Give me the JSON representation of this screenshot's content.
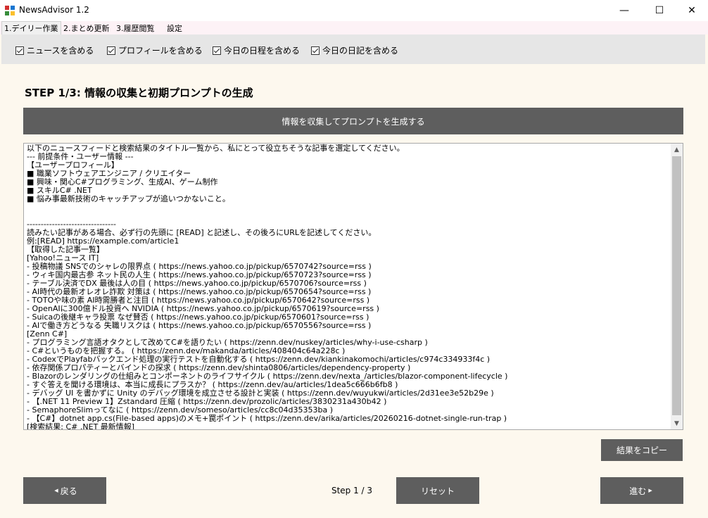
{
  "window": {
    "title": "NewsAdvisor 1.2",
    "minimize": "—",
    "maximize": "☐",
    "close": "✕"
  },
  "tabs": [
    {
      "label": "1.デイリー作業",
      "active": true
    },
    {
      "label": "2.まとめ更新",
      "active": false
    },
    {
      "label": "3.履歴閲覧",
      "active": false
    },
    {
      "label": "設定",
      "active": false
    }
  ],
  "options": [
    {
      "label": "ニュースを含める",
      "checked": true
    },
    {
      "label": "プロフィールを含める",
      "checked": true
    },
    {
      "label": "今日の日程を含める",
      "checked": true
    },
    {
      "label": "今日の日記を含める",
      "checked": true
    }
  ],
  "step_title": "STEP 1/3: 情報の収集と初期プロンプトの生成",
  "generate_button": "情報を収集してプロンプトを生成する",
  "prompt_lines": [
    "以下のニュースフィードと検索結果のタイトル一覧から、私にとって役立ちそうな記事を選定してください。",
    "--- 前提条件・ユーザー情報 ---",
    "【ユーザープロフィール】",
    "■ 職業ソフトウェアエンジニア / クリエイター",
    "■ 興味・関心C#プログラミング、生成AI、ゲーム制作",
    "■ スキルC# .NET",
    "■ 悩み事最新技術のキャッチアップが追いつかないこと。",
    "",
    "",
    "--------------------------------",
    "読みたい記事がある場合、必ず行の先頭に [READ] と記述し、その後ろにURLを記述してください。",
    "例:[READ] https://example.com/article1",
    "【取得した記事一覧】",
    "[Yahoo!ニュース IT]",
    "- 投稿物議 SNSでのシャレの限界点 ( https://news.yahoo.co.jp/pickup/6570742?source=rss )",
    "- ウィキ国内最古参 ネット民の人生 ( https://news.yahoo.co.jp/pickup/6570723?source=rss )",
    "- テーブル決済でDX 最後は人の目 ( https://news.yahoo.co.jp/pickup/6570706?source=rss )",
    "- AI時代の最新オレオレ詐欺 対策は ( https://news.yahoo.co.jp/pickup/6570654?source=rss )",
    "- TOTOや味の素 AI時需勝者と注目 ( https://news.yahoo.co.jp/pickup/6570642?source=rss )",
    "- OpenAIに300億ドル投資へ NVIDIA ( https://news.yahoo.co.jp/pickup/6570619?source=rss )",
    "- Suicaの後継キャラ投票 なぜ賛否 ( https://news.yahoo.co.jp/pickup/6570601?source=rss )",
    "- AIで働き方どうなる 失職リスクは ( https://news.yahoo.co.jp/pickup/6570556?source=rss )",
    "[Zenn C#]",
    "- プログラミング言語オタクとして改めてC#を語りたい ( https://zenn.dev/nuskey/articles/why-i-use-csharp )",
    "- C#というものを把握する。 ( https://zenn.dev/makanda/articles/408404c64a228c )",
    "- CodexでPlayfabバックエンド処理の実行テストを自動化する ( https://zenn.dev/kiankinakomochi/articles/c974c334933f4c )",
    "- 依存関係プロパティーとバインドの探求 ( https://zenn.dev/shinta0806/articles/dependency-property )",
    "- Blazorのレンダリングの仕組みとコンポーネントのライフサイクル ( https://zenn.dev/nexta_/articles/blazor-component-lifecycle )",
    "- すぐ答えを聞ける環境は、本当に成長にプラスか？ ( https://zenn.dev/au/articles/1dea5c666b6fb8 )",
    "- デバッグ UI を書かずに Unity のデバッグ環境を成立させる設計と実装 ( https://zenn.dev/wuyukwi/articles/2d31ee3e52b29e )",
    "- 【.NET 11 Preview 1】Zstandard 圧縮 ( https://zenn.dev/prozolic/articles/3830231a430b42 )",
    "- SemaphoreSlimってなに ( https://zenn.dev/someso/articles/cc8c04d35353ba )",
    "- 【C#】dotnet app.cs(File-based apps)のメモ+罠ポイント ( https://zenn.dev/arika/articles/20260216-dotnet-single-run-trap )",
    "[検索結果: C# .NET 最新情報]"
  ],
  "copy_button": "結果をコピー",
  "back_button": "戻る",
  "step_counter": "Step 1 / 3",
  "reset_button": "リセット",
  "next_button": "進む",
  "colors": {
    "button_bg": "#5e5e5e",
    "page_bg": "#fdf8ee",
    "option_bar_bg": "#e6e6e6"
  }
}
